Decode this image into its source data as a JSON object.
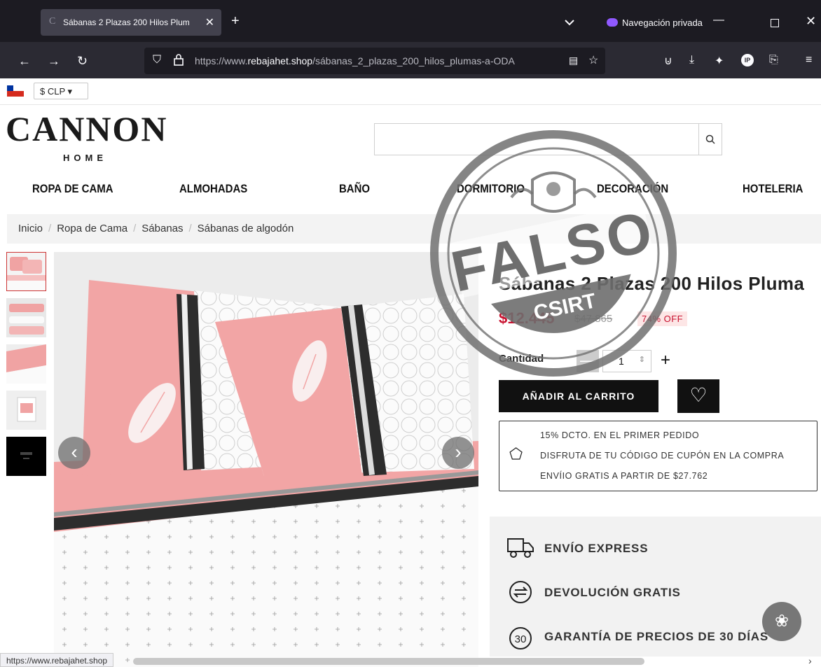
{
  "browser": {
    "tab_title": "Sábanas 2 Plazas 200 Hilos Plum",
    "tab_favicon": "C",
    "private_label": "Navegación privada",
    "url_prefix": "https://www.",
    "url_domain": "rebajahet.shop",
    "url_path": "/sábanas_2_plazas_200_hilos_plumas-a-ODA",
    "status_url": "https://www.rebajahet.shop"
  },
  "topbar": {
    "currency": "$ CLP ▾"
  },
  "header": {
    "logo": "CANNON",
    "logo_sub": "HOME",
    "search_placeholder": ""
  },
  "menu": [
    "ROPA DE CAMA",
    "ALMOHADAS",
    "BAÑO",
    "DORMITORIO",
    "DECORACIÓN",
    "HOTELERIA"
  ],
  "breadcrumb": [
    "Inicio",
    "Ropa de Cama",
    "Sábanas",
    "Sábanas de algodón"
  ],
  "product": {
    "title": "Sábanas 2 Plazas 200 Hilos Pluma",
    "price": "$12.445",
    "old_price": "$47.865",
    "discount": "74% OFF",
    "qty_label": "Cantidad",
    "qty_value": "1",
    "add_to_cart": "AÑADIR AL CARRITO"
  },
  "promo": {
    "line1": "15% DCTO. EN EL PRIMER PEDIDO",
    "line2": "DISFRUTA DE TU CÓDIGO DE CUPÓN EN LA COMPRA",
    "line3": "ENVÍIO GRATIS A PARTIR DE $27.762"
  },
  "features": [
    "ENVÍO EXPRESS",
    "DEVOLUCIÓN GRATIS",
    "GARANTÍA DE PRECIOS DE 30 DÍAS"
  ],
  "stamp": {
    "word": "FALSO",
    "org": "CSIRT"
  },
  "colors": {
    "accent_red": "#c8102e",
    "browser_dark": "#1c1b22",
    "stamp_gray": "#6e6e6e"
  }
}
